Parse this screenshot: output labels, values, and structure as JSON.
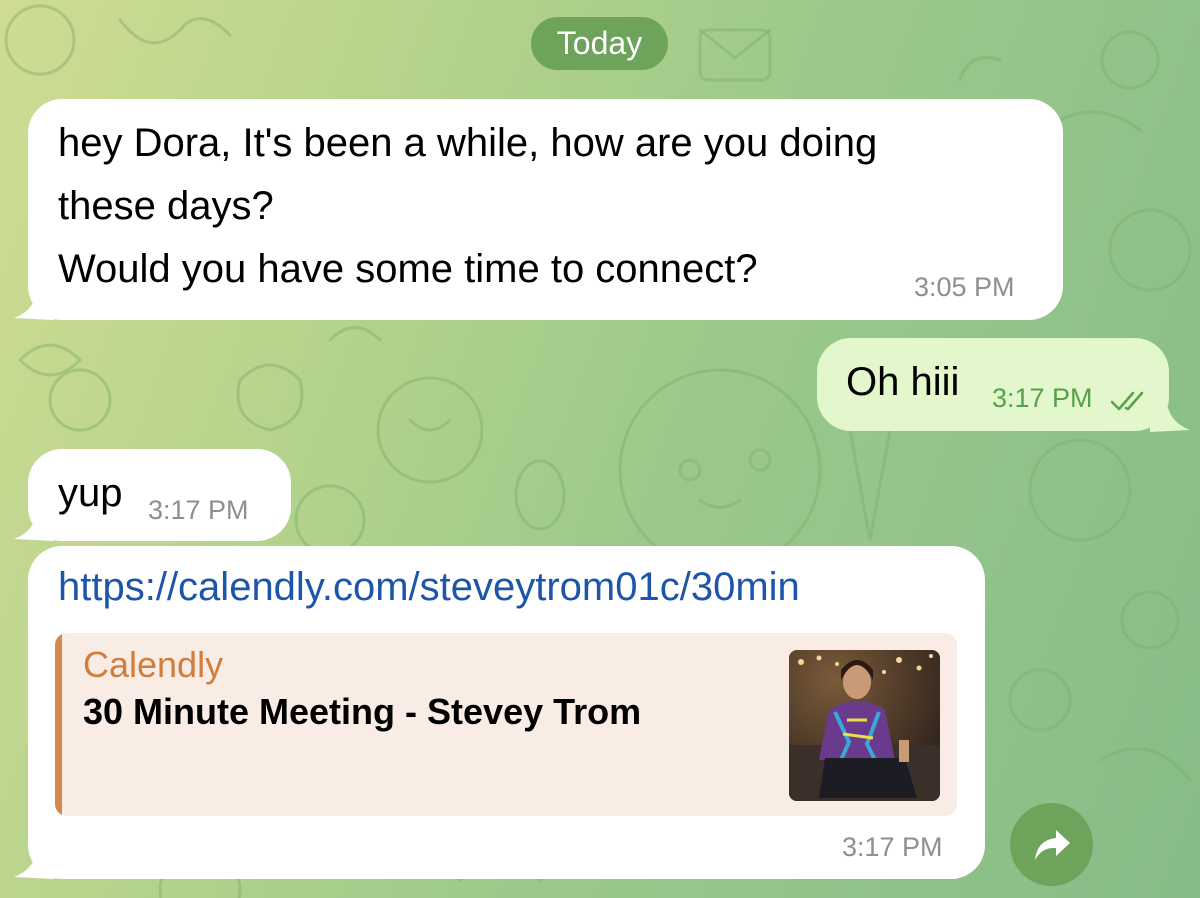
{
  "chat": {
    "date_separator": "Today",
    "messages": [
      {
        "direction": "incoming",
        "lines": [
          "hey Dora, It's been a while, how are you doing",
          "these days?",
          "Would you have some time to connect?"
        ],
        "time": "3:05 PM"
      },
      {
        "direction": "outgoing",
        "text": "Oh hiii",
        "time": "3:17 PM",
        "status": "read"
      },
      {
        "direction": "incoming",
        "text": "yup",
        "time": "3:17 PM"
      },
      {
        "direction": "incoming",
        "link": "https://calendly.com/steveytrom01c/30min",
        "preview": {
          "site_name": "Calendly",
          "title": "30 Minute Meeting - Stevey Trom",
          "thumbnail_icon": "person-photo-thumbnail"
        },
        "time": "3:17 PM"
      }
    ]
  },
  "colors": {
    "date_chip": "#6ea35c",
    "incoming_bubble": "#ffffff",
    "outgoing_bubble": "#e2f7cb",
    "link": "#1d56a8",
    "preview_accent": "#d5894a",
    "outgoing_time": "#58a04a"
  },
  "icons": {
    "read_status": "double-check-icon",
    "share": "share-forward-icon"
  }
}
